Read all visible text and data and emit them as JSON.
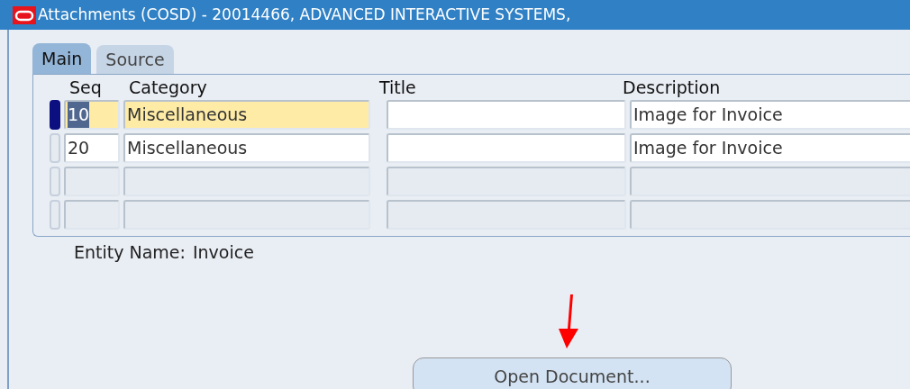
{
  "window": {
    "title": "Attachments (COSD) - 20014466, ADVANCED INTERACTIVE SYSTEMS,"
  },
  "tabs": [
    {
      "label": "Main",
      "selected": true
    },
    {
      "label": "Source",
      "selected": false
    }
  ],
  "table": {
    "columns": [
      "Seq",
      "Category",
      "Title",
      "Description"
    ],
    "rows": [
      {
        "kind": "record",
        "selected": true,
        "seq": "10",
        "category": "Miscellaneous",
        "description": "Image for Invoice"
      },
      {
        "kind": "record",
        "selected": false,
        "seq": "20",
        "category": "Miscellaneous",
        "description": "Image for Invoice"
      },
      {
        "kind": "empty",
        "selected": false
      },
      {
        "kind": "empty",
        "selected": false
      }
    ]
  },
  "entity": {
    "label": "Entity Name:",
    "value": "Invoice"
  },
  "buttons": [
    {
      "label": "Open Document..."
    }
  ]
}
